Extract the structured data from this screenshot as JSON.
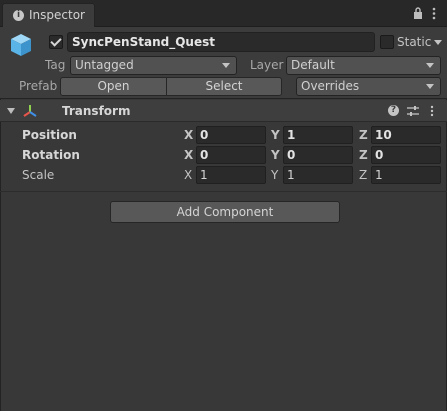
{
  "tab": {
    "label": "Inspector",
    "icon": "info-icon"
  },
  "header": {
    "active": true,
    "object_name": "SyncPenStand_Quest",
    "static_label": "Static",
    "static_checked": false,
    "tag_label": "Tag",
    "tag_value": "Untagged",
    "layer_label": "Layer",
    "layer_value": "Default",
    "prefab_label": "Prefab",
    "open_label": "Open",
    "select_label": "Select",
    "overrides_label": "Overrides"
  },
  "transform": {
    "title": "Transform",
    "expanded": true,
    "rows": [
      {
        "label": "Position",
        "x": "0",
        "y": "1",
        "z": "10"
      },
      {
        "label": "Rotation",
        "x": "0",
        "y": "0",
        "z": "0"
      },
      {
        "label": "Scale",
        "x": "1",
        "y": "1",
        "z": "1"
      }
    ],
    "axis_labels": {
      "x": "X",
      "y": "Y",
      "z": "Z"
    }
  },
  "add_component_label": "Add Component",
  "colors": {
    "background": "#383838",
    "tab_bar": "#282828",
    "field": "#2a2a2a",
    "button": "#585858",
    "cube_blue": "#5ab4e8",
    "axis_red": "#e8554a",
    "axis_green": "#8fd14f",
    "axis_blue": "#3f8fe8"
  }
}
